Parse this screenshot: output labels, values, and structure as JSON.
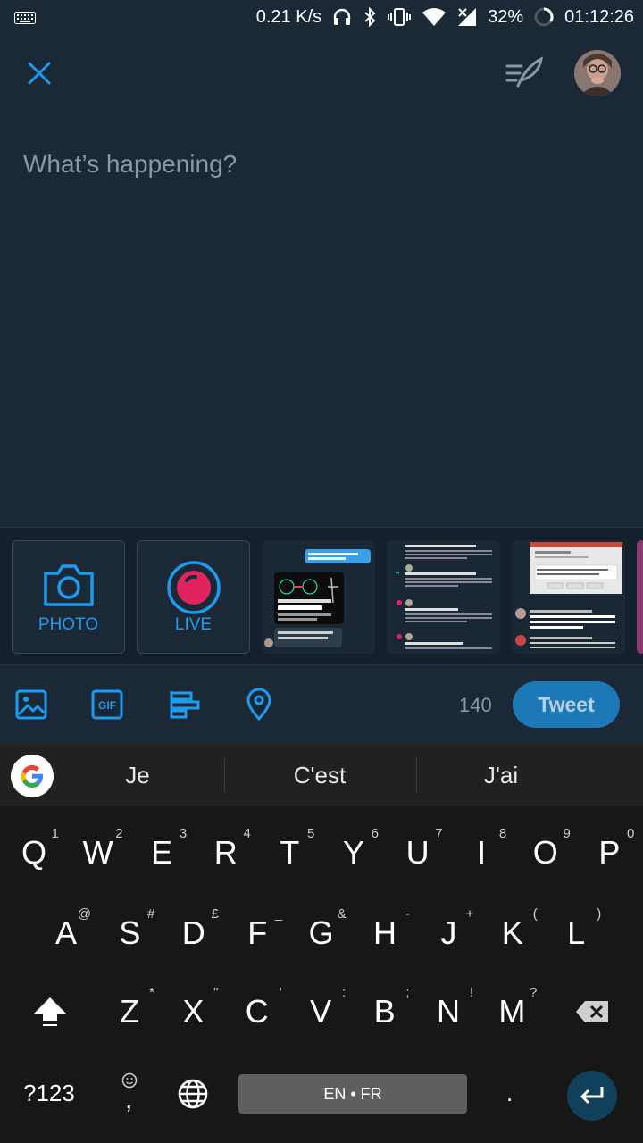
{
  "status_bar": {
    "net_speed": "0.21 K/s",
    "battery": "32%",
    "time": "01:12:26",
    "icons": [
      "keyboard-icon",
      "headphones-icon",
      "bluetooth-icon",
      "vibrate-icon",
      "wifi-icon",
      "signal-icon",
      "battery-icon"
    ]
  },
  "compose": {
    "placeholder": "What’s happening?"
  },
  "tray": {
    "photo_label": "PHOTO",
    "live_label": "LIVE"
  },
  "toolbar": {
    "char_count": "140",
    "tweet_label": "Tweet"
  },
  "keyboard": {
    "suggestions": [
      "Je",
      "C'est",
      "J'ai"
    ],
    "row1": [
      {
        "k": "Q",
        "h": "1"
      },
      {
        "k": "W",
        "h": "2"
      },
      {
        "k": "E",
        "h": "3"
      },
      {
        "k": "R",
        "h": "4"
      },
      {
        "k": "T",
        "h": "5"
      },
      {
        "k": "Y",
        "h": "6"
      },
      {
        "k": "U",
        "h": "7"
      },
      {
        "k": "I",
        "h": "8"
      },
      {
        "k": "O",
        "h": "9"
      },
      {
        "k": "P",
        "h": "0"
      }
    ],
    "row2": [
      {
        "k": "A",
        "h": "@"
      },
      {
        "k": "S",
        "h": "#"
      },
      {
        "k": "D",
        "h": "£"
      },
      {
        "k": "F",
        "h": "_"
      },
      {
        "k": "G",
        "h": "&"
      },
      {
        "k": "H",
        "h": "-"
      },
      {
        "k": "J",
        "h": "+"
      },
      {
        "k": "K",
        "h": "("
      },
      {
        "k": "L",
        "h": ")"
      }
    ],
    "row3": [
      {
        "k": "Z",
        "h": "*"
      },
      {
        "k": "X",
        "h": "\""
      },
      {
        "k": "C",
        "h": "'"
      },
      {
        "k": "V",
        "h": ":"
      },
      {
        "k": "B",
        "h": ";"
      },
      {
        "k": "N",
        "h": "!"
      },
      {
        "k": "M",
        "h": "?"
      }
    ],
    "symbols_label": "?123",
    "comma_label": ",",
    "space_label": "EN • FR",
    "period_label": "."
  },
  "colors": {
    "accent": "#1d9bf0",
    "background": "#1b2836",
    "live_red": "#e0245e"
  }
}
